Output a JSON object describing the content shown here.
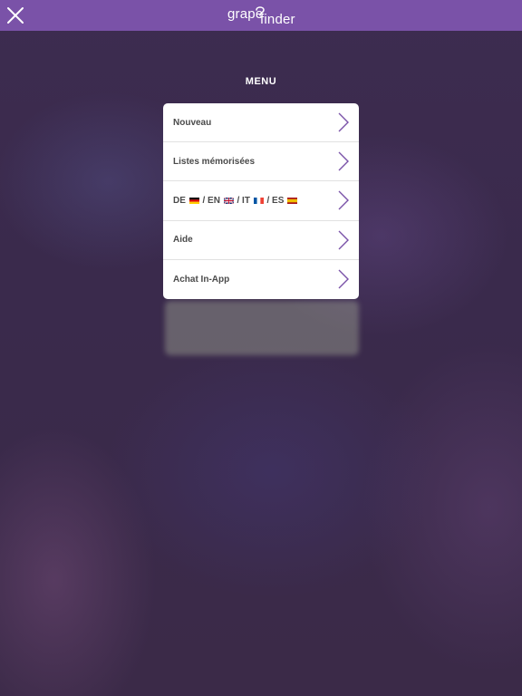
{
  "header": {
    "logo_part1": "grape",
    "logo_part2": "finder",
    "close_icon": "close-icon",
    "color": "#7a52a8"
  },
  "menu": {
    "title": "MENU",
    "items": [
      {
        "label": "Nouveau"
      },
      {
        "label": "Listes mémorisées"
      },
      {
        "label_parts": [
          "DE",
          "/ EN",
          "/ IT",
          "/ ES"
        ],
        "flags": [
          "de-flag-icon",
          "uk-flag-icon",
          "fr-flag-icon",
          "es-flag-icon"
        ]
      },
      {
        "label": "Aide"
      },
      {
        "label": "Achat In-App"
      }
    ],
    "chevron_icon": "chevron-right-icon",
    "accent": "#7a52a8"
  }
}
